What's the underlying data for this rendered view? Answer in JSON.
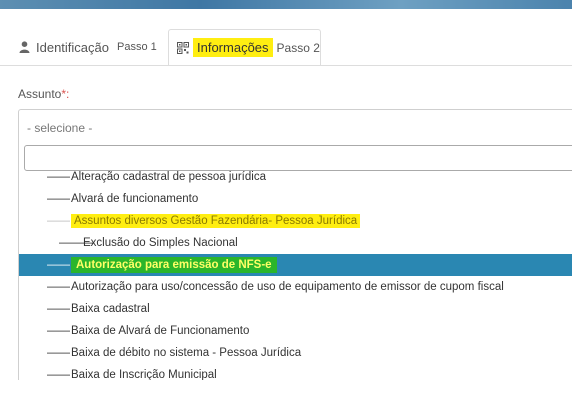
{
  "tabs": [
    {
      "icon": "user-icon",
      "label": "Identificação",
      "step": "Passo 1"
    },
    {
      "icon": "qrcode-icon",
      "label": "Informações",
      "step": "Passo 2"
    }
  ],
  "field": {
    "label": "Assunto",
    "required_mark": "*:"
  },
  "select": {
    "current": "- selecione -",
    "search_value": ""
  },
  "options": [
    {
      "dash": "——",
      "label": "Alteração cadastral de pessoa jurídica",
      "kind": "item"
    },
    {
      "dash": "——",
      "label": "Alvará de funcionamento",
      "kind": "item"
    },
    {
      "dash": "——",
      "label": "Assuntos diversos Gestão Fazendária- Pessoa Jurídica",
      "kind": "group"
    },
    {
      "dash": "———",
      "label": "Exclusão do Simples Nacional",
      "kind": "child"
    },
    {
      "dash": "——",
      "label": "Autorização para emissão de NFS-e",
      "kind": "selected"
    },
    {
      "dash": "——",
      "label": "Autorização para uso/concessão de uso de equipamento de emissor de cupom fiscal",
      "kind": "item"
    },
    {
      "dash": "——",
      "label": "Baixa cadastral",
      "kind": "item"
    },
    {
      "dash": "——",
      "label": "Baixa de Alvará de Funcionamento",
      "kind": "item"
    },
    {
      "dash": "——",
      "label": "Baixa de débito no sistema - Pessoa Jurídica",
      "kind": "item"
    },
    {
      "dash": "——",
      "label": "Baixa de Inscrição Municipal",
      "kind": "item"
    }
  ],
  "colors": {
    "highlight_yellow": "#ffee11",
    "selected_bg": "#2a87b2",
    "selected_label_bg": "#2bb52b",
    "required": "#d9534f"
  }
}
